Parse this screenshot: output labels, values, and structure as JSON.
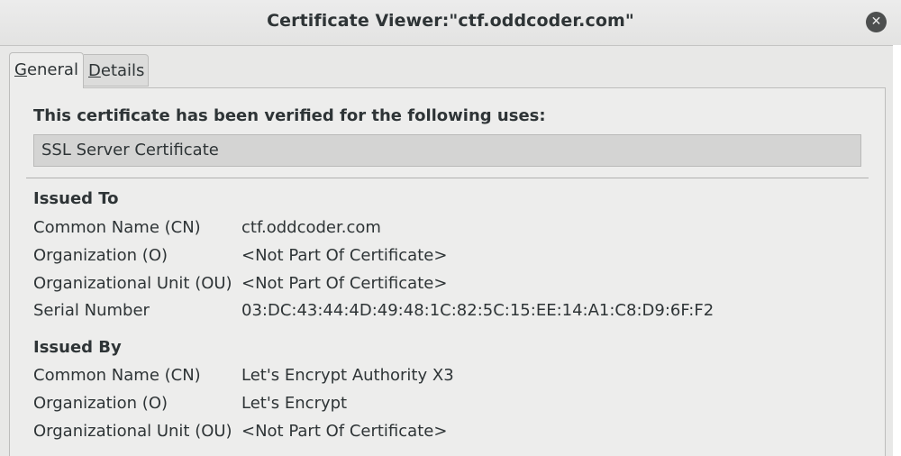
{
  "window": {
    "title": "Certificate Viewer:\"ctf.oddcoder.com\"",
    "close_glyph": "✕"
  },
  "tabs": [
    {
      "mnemonic": "G",
      "rest": "eneral",
      "active": true
    },
    {
      "mnemonic": "D",
      "rest": "etails",
      "active": false
    }
  ],
  "general": {
    "verified_heading": "This certificate has been verified for the following uses:",
    "uses": "SSL Server Certificate",
    "issued_to": {
      "heading": "Issued To",
      "fields": [
        {
          "label": "Common Name (CN)",
          "value": "ctf.oddcoder.com"
        },
        {
          "label": "Organization (O)",
          "value": "<Not Part Of Certificate>"
        },
        {
          "label": "Organizational Unit (OU)",
          "value": "<Not Part Of Certificate>"
        },
        {
          "label": "Serial Number",
          "value": "03:DC:43:44:4D:49:48:1C:82:5C:15:EE:14:A1:C8:D9:6F:F2"
        }
      ]
    },
    "issued_by": {
      "heading": "Issued By",
      "fields": [
        {
          "label": "Common Name (CN)",
          "value": "Let's Encrypt Authority X3"
        },
        {
          "label": "Organization (O)",
          "value": "Let's Encrypt"
        },
        {
          "label": "Organizational Unit (OU)",
          "value": "<Not Part Of Certificate>"
        }
      ]
    }
  }
}
